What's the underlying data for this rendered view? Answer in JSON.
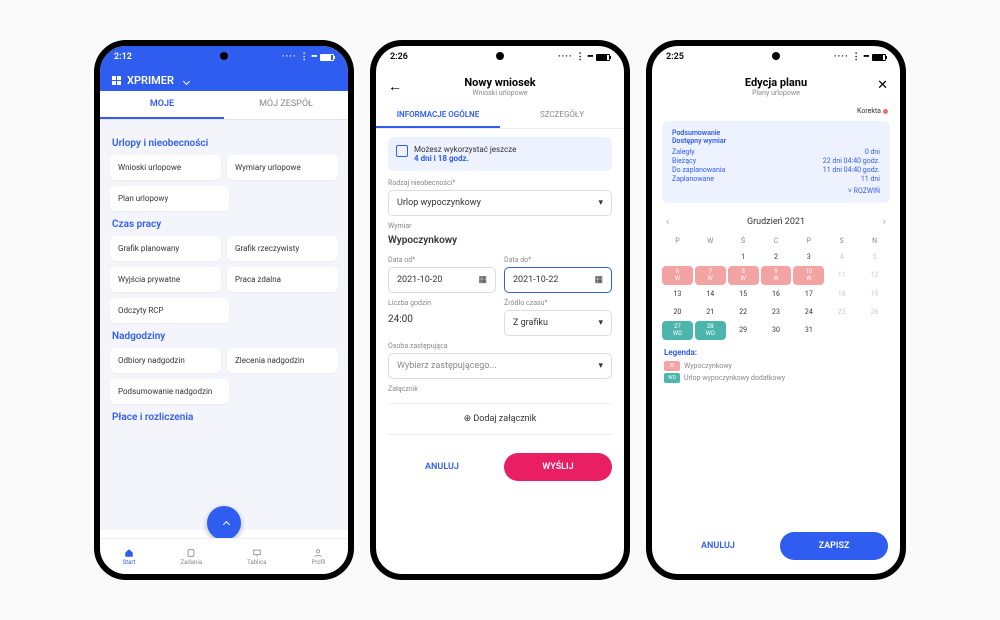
{
  "phone1": {
    "time": "2:12",
    "brand": "XPRIMER",
    "tabs": [
      "MOJE",
      "MÓJ ZESPÓŁ"
    ],
    "sections": [
      {
        "title": "Urlopy i nieobecności",
        "tiles": [
          "Wnioski urlopowe",
          "Wymiary urlopowe",
          "Plan urlopowy"
        ]
      },
      {
        "title": "Czas pracy",
        "tiles": [
          "Grafik planowany",
          "Grafik rzeczywisty",
          "Wyjścia prywatne",
          "Praca zdalna",
          "Odczyty RCP"
        ]
      },
      {
        "title": "Nadgodziny",
        "tiles": [
          "Odbiory nadgodzin",
          "Zlecenia nadgodzin",
          "Podsumowanie nadgodzin"
        ]
      },
      {
        "title": "Płace i rozliczenia",
        "tiles": []
      }
    ],
    "nav": [
      "Start",
      "Zadania",
      "Tablica",
      "Profil"
    ]
  },
  "phone2": {
    "time": "2:26",
    "title": "Nowy wniosek",
    "subtitle": "Wnioski urlopowe",
    "tabs": [
      "INFORMACJE OGÓLNE",
      "SZCZEGÓŁY"
    ],
    "note_l1": "Możesz wykorzystać jeszcze",
    "note_l2": "4 dni i 18 godz.",
    "type_label": "Rodzaj nieobecności*",
    "type_value": "Urlop wypoczynkowy",
    "dim_label": "Wymiar",
    "dim_value": "Wypoczynkowy",
    "from_label": "Data od*",
    "from_value": "2021-10-20",
    "to_label": "Data do*",
    "to_value": "2021-10-22",
    "hours_label": "Liczba godzin",
    "hours_value": "24:00",
    "src_label": "Źródło czasu*",
    "src_value": "Z grafiku",
    "sub_label": "Osoba zastępująca",
    "sub_value": "Wybierz zastępującego...",
    "att_label": "Załącznik",
    "att_btn": "Dodaj załącznik",
    "cancel": "ANULUJ",
    "submit": "WYŚLIJ"
  },
  "phone3": {
    "time": "2:25",
    "title": "Edycja planu",
    "subtitle": "Plany urlopowe",
    "korekta": "Korekta",
    "sum_title": "Podsumowanie",
    "sum_sub": "Dostępny wymiar",
    "rows": [
      [
        "Zaległy",
        "0 dni"
      ],
      [
        "Bieżący",
        "22 dni 04:40 godz."
      ],
      [
        "Do zaplanowania",
        "11 dni 04:40 godz."
      ],
      [
        "Zaplanowane",
        "11 dni"
      ]
    ],
    "expand": "ROZWIŃ",
    "month": "Grudzień 2021",
    "weekdays": [
      "P",
      "W",
      "Ś",
      "C",
      "P",
      "S",
      "N"
    ],
    "legend_title": "Legenda:",
    "legend": [
      {
        "code": "W",
        "color": "#f4a3a3",
        "text": "Wypoczynkowy"
      },
      {
        "code": "WD",
        "color": "#4db6ac",
        "text": "Urlop wypoczynkowy dodatkowy"
      }
    ],
    "cancel": "ANULUJ",
    "save": "ZAPISZ"
  }
}
